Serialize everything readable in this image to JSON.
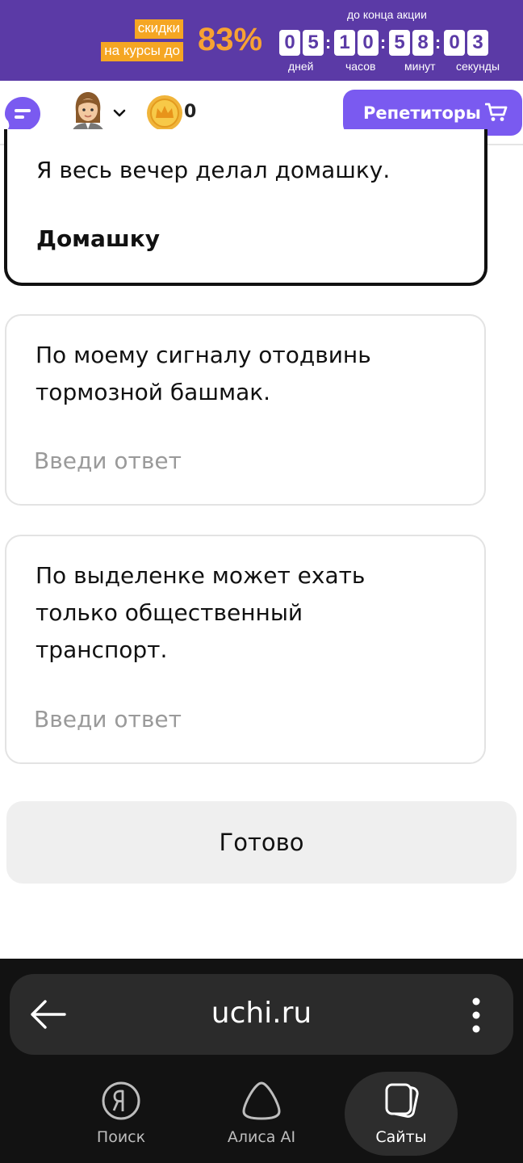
{
  "promo": {
    "tag_line1": "скидки",
    "tag_line2": "на курсы до",
    "percent": "83%",
    "until": "до конца акции",
    "timer": {
      "days": [
        "0",
        "5"
      ],
      "hours": [
        "1",
        "0"
      ],
      "minutes": [
        "5",
        "8"
      ],
      "seconds": [
        "0",
        "3"
      ],
      "separator": ":",
      "days_label": "дней",
      "hours_label": "часов",
      "minutes_label": "минут",
      "seconds_label": "секунды"
    }
  },
  "header": {
    "coin_count": "0",
    "tutors_label": "Репетиторы"
  },
  "exercise": {
    "items": [
      {
        "sentence": "Я весь вечер делал домашку.",
        "answer": "Домашку"
      },
      {
        "sentence_lines": [
          "По моему сигналу отодвинь",
          "тормозной башмак."
        ],
        "placeholder": "Введи ответ"
      },
      {
        "sentence_lines": [
          "По выделенке может ехать",
          "только общественный",
          "транспорт."
        ],
        "placeholder": "Введи ответ"
      }
    ],
    "done_label": "Готово"
  },
  "browser": {
    "url": "uchi.ru",
    "nav": [
      {
        "label": "Поиск",
        "icon": "yandex-search-icon"
      },
      {
        "label": "Алиса AI",
        "icon": "alice-icon"
      },
      {
        "label": "Сайты",
        "icon": "sites-icon",
        "active": true
      }
    ]
  },
  "colors": {
    "promo_bg": "#5b3aa6",
    "promo_accent": "#f5a623",
    "brand_button": "#7a5af0",
    "browser_bg": "#121212"
  }
}
